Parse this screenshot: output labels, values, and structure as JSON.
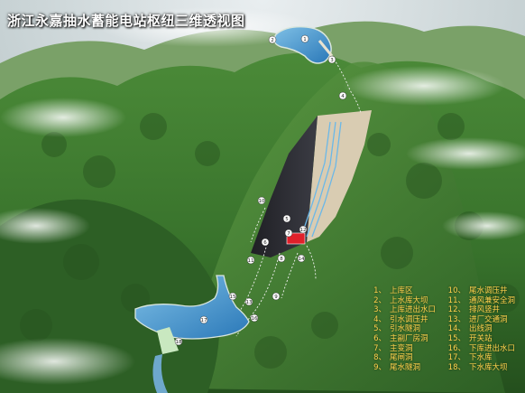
{
  "title": "浙江永嘉抽水蓄能电站枢纽三维透视图",
  "legend": {
    "items": [
      {
        "num": "1、",
        "label": "上库区"
      },
      {
        "num": "2、",
        "label": "上水库大坝"
      },
      {
        "num": "3、",
        "label": "上库进出水口"
      },
      {
        "num": "4、",
        "label": "引水调压井"
      },
      {
        "num": "5、",
        "label": "引水隧洞"
      },
      {
        "num": "6、",
        "label": "主副厂房洞"
      },
      {
        "num": "7、",
        "label": "主变洞"
      },
      {
        "num": "8、",
        "label": "尾闸洞"
      },
      {
        "num": "9、",
        "label": "尾水隧洞"
      },
      {
        "num": "10、",
        "label": "尾水调压井"
      },
      {
        "num": "11、",
        "label": "通风兼安全洞"
      },
      {
        "num": "12、",
        "label": "排风竖井"
      },
      {
        "num": "13、",
        "label": "进厂交通洞"
      },
      {
        "num": "14、",
        "label": "出线洞"
      },
      {
        "num": "15、",
        "label": "开关站"
      },
      {
        "num": "16、",
        "label": "下库进出水口"
      },
      {
        "num": "17、",
        "label": "下水库"
      },
      {
        "num": "18、",
        "label": "下水库大坝"
      }
    ]
  },
  "markers": [
    "1",
    "2",
    "3",
    "4",
    "5",
    "6",
    "7",
    "8",
    "9",
    "10",
    "11",
    "12",
    "13",
    "14",
    "15",
    "16",
    "17",
    "18"
  ],
  "colors": {
    "legend_text": "#ffd34d",
    "title_text": "#ffffff",
    "water": "#3a8fd0",
    "forest": "#3f7a2e",
    "excavation": "#2b2b30",
    "spoil": "#d8cbb0",
    "powerhouse": "#e0202a"
  }
}
